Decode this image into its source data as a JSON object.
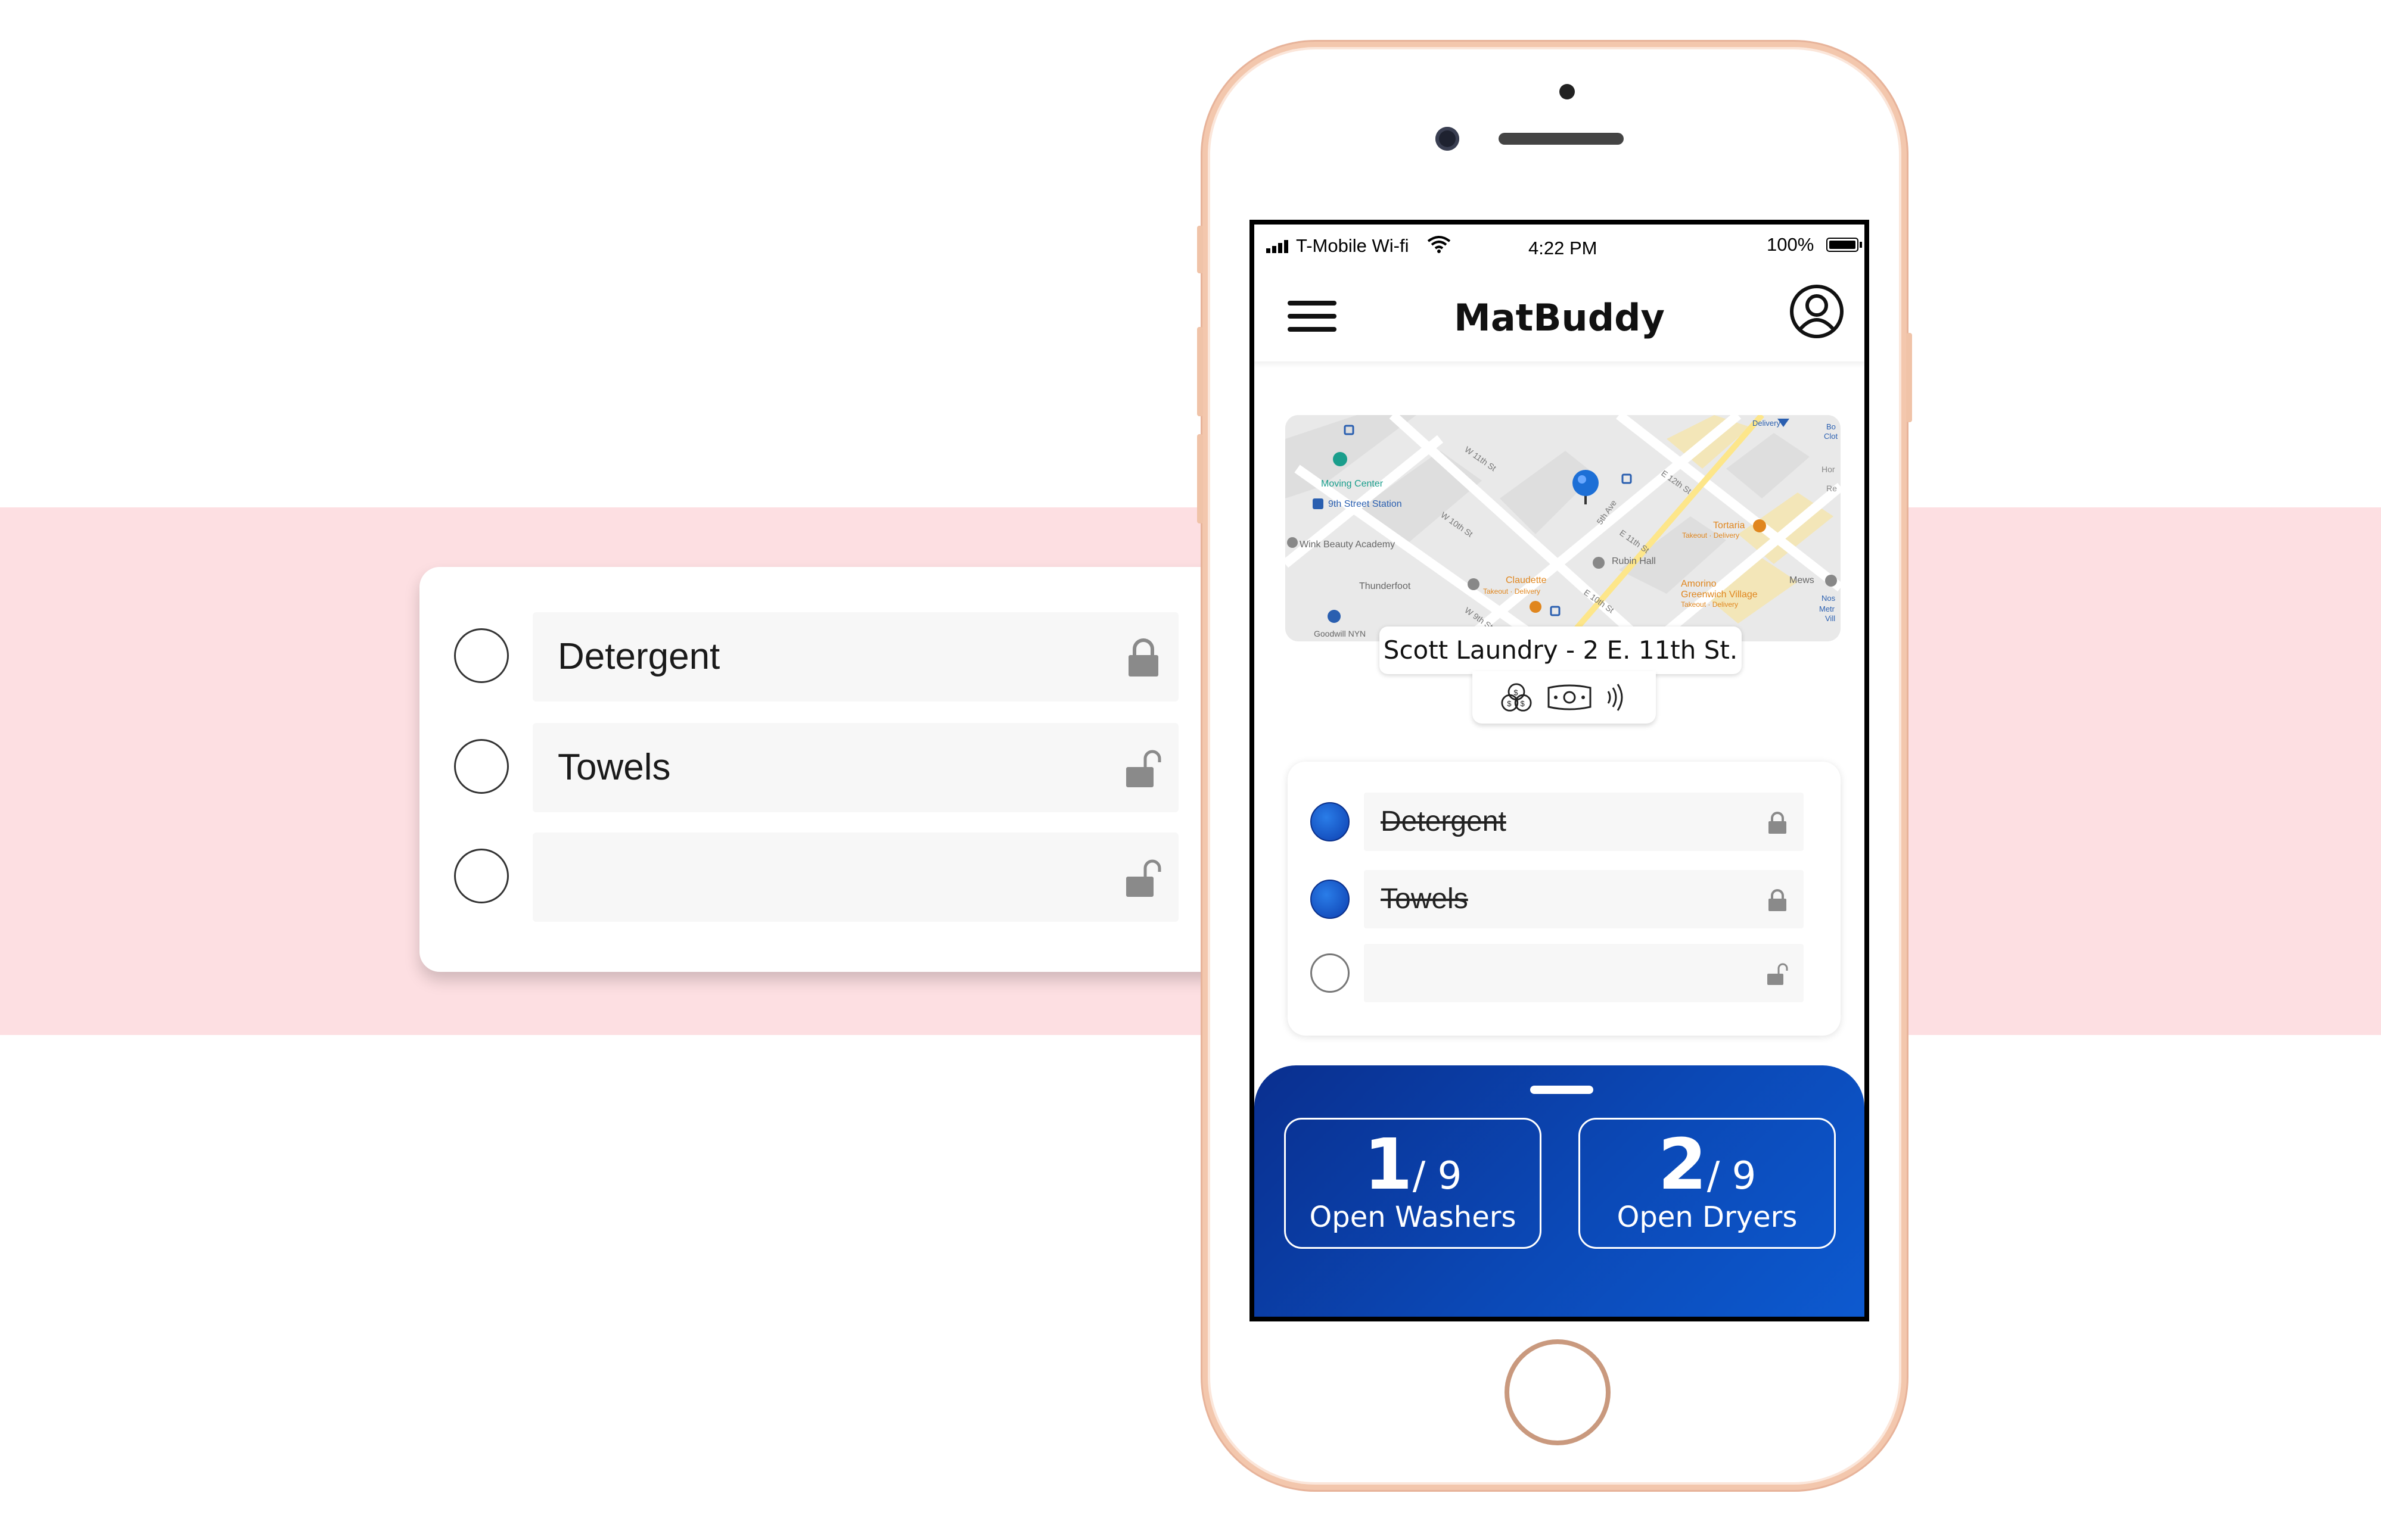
{
  "status_bar": {
    "carrier": "T-Mobile Wi-fi",
    "time": "4:22 PM",
    "battery": "100%"
  },
  "app": {
    "title": "MatBuddy"
  },
  "location": {
    "name": "Scott Laundry - 2 E. 11th St."
  },
  "map_labels": {
    "delivery": "Delivery",
    "moving_center": "Moving Center",
    "station": "9th Street Station",
    "wink": "Wink Beauty Academy",
    "thunderfoot": "Thunderfoot",
    "claudette": "Claudette",
    "claudette_sub": "Takeout · Delivery",
    "tortaria": "Tortaria",
    "tortaria_sub": "Takeout · Delivery",
    "rubin": "Rubin Hall",
    "amorino": "Amorino",
    "amorino_sub1": "Greenwich Village",
    "amorino_sub2": "Takeout · Delivery",
    "mews": "Mews",
    "goodwill": "Goodwill NYN",
    "w11": "W 11th St",
    "w10": "W 10th St",
    "w9": "W 9th St",
    "e12": "E 12th St",
    "e11": "E 11th St",
    "e10": "E 10th St",
    "fifth": "5th Ave",
    "edge1": "Bo",
    "edge2": "Clot",
    "edge3": "Hor",
    "edge4": "Re",
    "edge5": "Nos",
    "edge6": "Metr",
    "edge7": "Vill"
  },
  "payment_icons": [
    "coins-icon",
    "cash-icon",
    "contactless-icon"
  ],
  "phone_checklist": [
    {
      "label": "Detergent",
      "checked": true,
      "locked": true
    },
    {
      "label": "Towels",
      "checked": true,
      "locked": true
    },
    {
      "label": "",
      "checked": false,
      "locked": false
    }
  ],
  "floating_checklist": [
    {
      "label": "Detergent",
      "checked": false,
      "locked": true
    },
    {
      "label": "Towels",
      "checked": false,
      "locked": false
    },
    {
      "label": "",
      "checked": false,
      "locked": false
    }
  ],
  "machines": {
    "washers": {
      "open": "1",
      "total": "/ 9",
      "label": "Open Washers"
    },
    "dryers": {
      "open": "2",
      "total": "/ 9",
      "label": "Open Dryers"
    }
  },
  "colors": {
    "band": "#fddfe2",
    "drawer_blue": "#0b49b7",
    "phone_frame": "#f3c7ad"
  }
}
